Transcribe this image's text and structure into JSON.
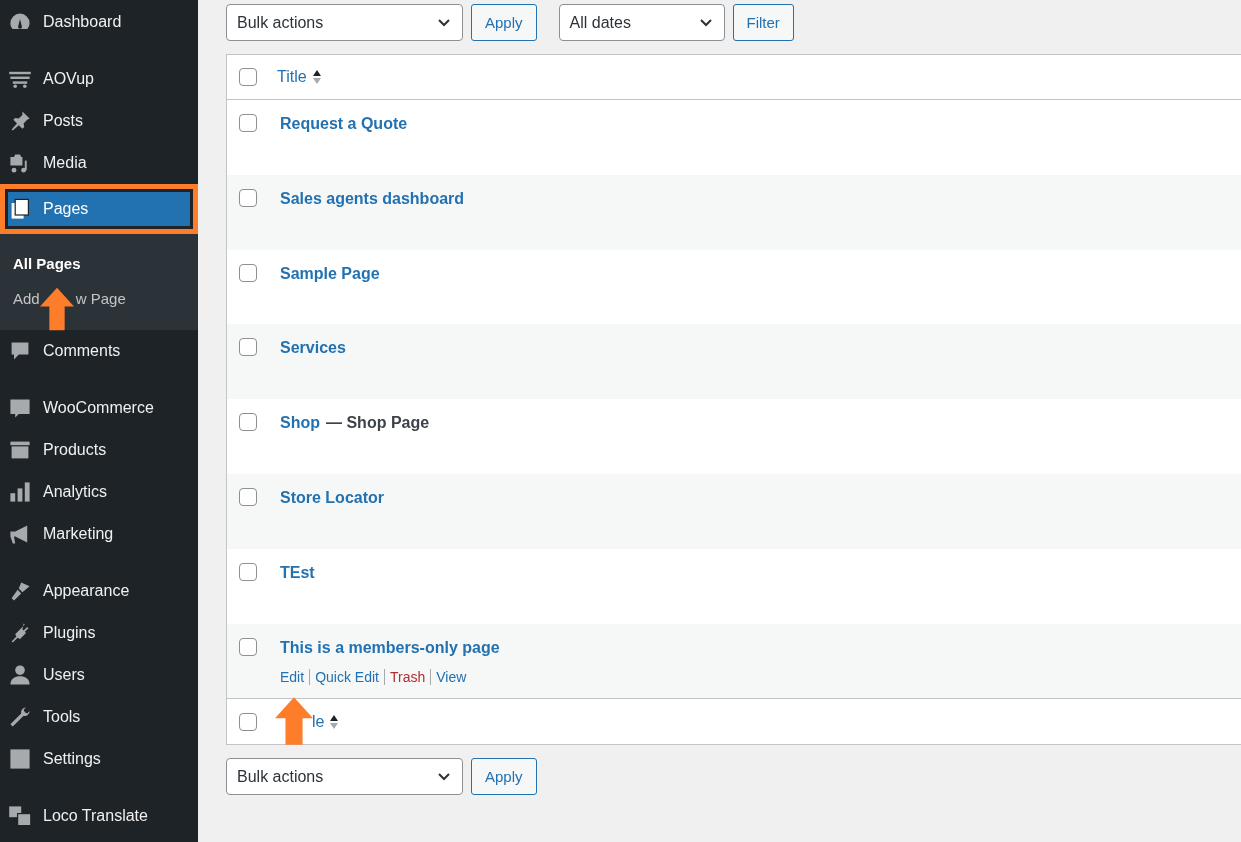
{
  "sidebar": {
    "items": [
      {
        "kind": "item",
        "label": "Dashboard",
        "selected": false
      },
      {
        "kind": "separator"
      },
      {
        "kind": "item",
        "label": "AOVup",
        "selected": false
      },
      {
        "kind": "item",
        "label": "Posts",
        "selected": false
      },
      {
        "kind": "item",
        "label": "Media",
        "selected": false
      },
      {
        "kind": "item",
        "label": "Pages",
        "selected": true,
        "submenu": [
          {
            "label": "All Pages",
            "selected": true
          },
          {
            "label_parts": [
              "Add",
              "w Page"
            ],
            "selected": false
          }
        ]
      },
      {
        "kind": "item",
        "label": "Comments",
        "selected": false
      },
      {
        "kind": "separator"
      },
      {
        "kind": "item",
        "label": "WooCommerce",
        "selected": false
      },
      {
        "kind": "item",
        "label": "Products",
        "selected": false
      },
      {
        "kind": "item",
        "label": "Analytics",
        "selected": false
      },
      {
        "kind": "item",
        "label": "Marketing",
        "selected": false
      },
      {
        "kind": "separator"
      },
      {
        "kind": "item",
        "label": "Appearance",
        "selected": false
      },
      {
        "kind": "item",
        "label": "Plugins",
        "selected": false
      },
      {
        "kind": "item",
        "label": "Users",
        "selected": false
      },
      {
        "kind": "item",
        "label": "Tools",
        "selected": false
      },
      {
        "kind": "item",
        "label": "Settings",
        "selected": false
      },
      {
        "kind": "separator"
      },
      {
        "kind": "item",
        "label": "Loco Translate",
        "selected": false
      }
    ]
  },
  "top_toolbar": {
    "bulk_actions": "Bulk actions",
    "apply": "Apply",
    "dates": "All dates",
    "filter": "Filter"
  },
  "table": {
    "header": {
      "title": "Title",
      "checked": false
    },
    "rows": [
      {
        "title": "Request a Quote",
        "checked": false
      },
      {
        "title": "Sales agents dashboard",
        "checked": false
      },
      {
        "title": "Sample Page",
        "checked": false
      },
      {
        "title": "Services",
        "checked": false
      },
      {
        "title": "Shop",
        "post_state": "— Shop Page",
        "checked": false
      },
      {
        "title": "Store Locator",
        "checked": false
      },
      {
        "title": "TEst",
        "checked": false
      },
      {
        "title": "This is a members-only page",
        "checked": false,
        "row_actions": [
          {
            "label": "Edit",
            "kind": "link"
          },
          {
            "label": "Quick Edit",
            "kind": "link"
          },
          {
            "label": "Trash",
            "kind": "delete"
          },
          {
            "label": "View",
            "kind": "link"
          }
        ]
      }
    ],
    "footer": {
      "title_visible": "le",
      "checked": false
    }
  },
  "bottom_toolbar": {
    "bulk_actions": "Bulk actions",
    "apply": "Apply"
  }
}
